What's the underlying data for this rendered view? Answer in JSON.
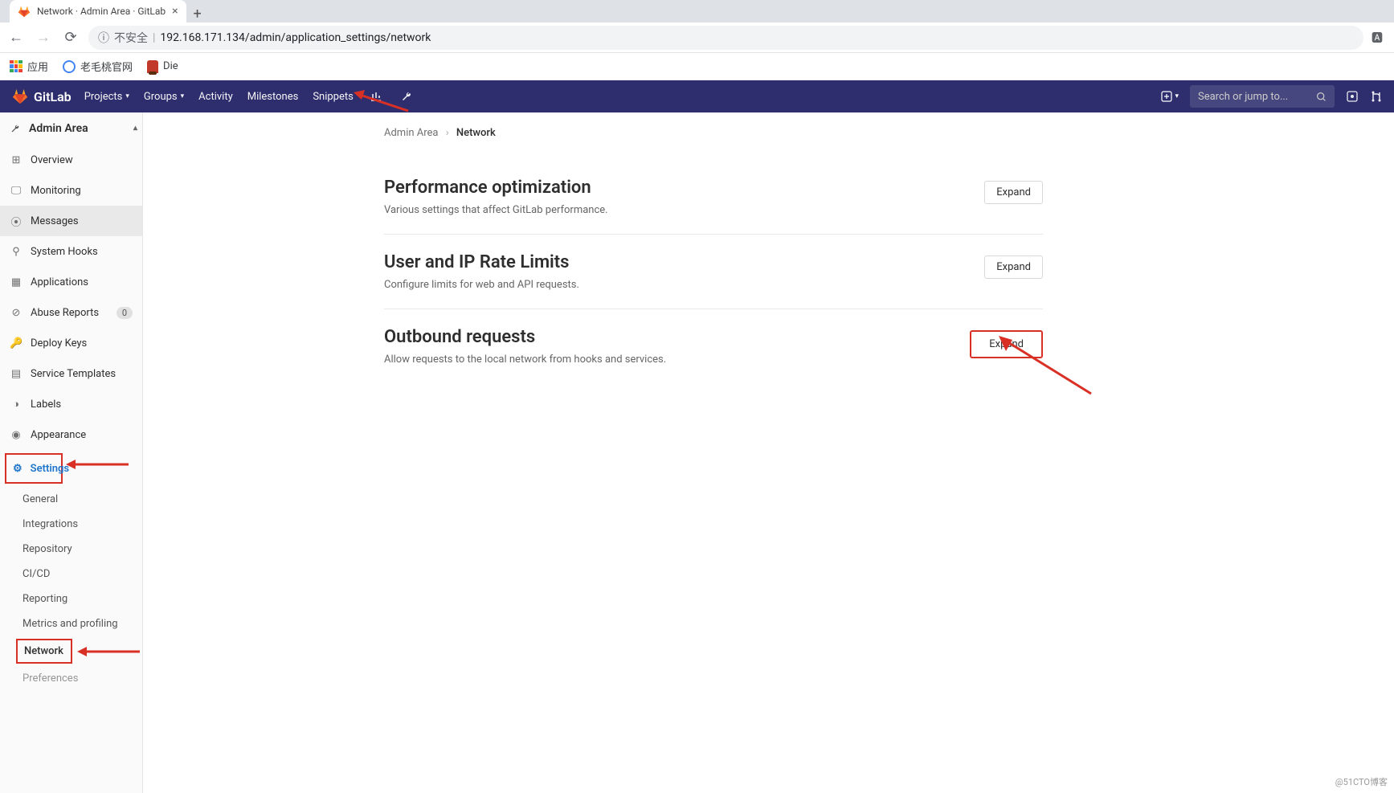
{
  "browser": {
    "tab_title": "Network · Admin Area · GitLab",
    "url_prefix_label": "不安全",
    "url": "192.168.171.134/admin/application_settings/network",
    "bookmarks": {
      "apps": "应用",
      "laomaotao": "老毛桃官网",
      "die": "Die"
    }
  },
  "header": {
    "brand": "GitLab",
    "nav": {
      "projects": "Projects",
      "groups": "Groups",
      "activity": "Activity",
      "milestones": "Milestones",
      "snippets": "Snippets"
    },
    "search_placeholder": "Search or jump to..."
  },
  "sidebar": {
    "title": "Admin Area",
    "items": {
      "overview": "Overview",
      "monitoring": "Monitoring",
      "messages": "Messages",
      "system_hooks": "System Hooks",
      "applications": "Applications",
      "abuse_reports": "Abuse Reports",
      "abuse_reports_count": "0",
      "deploy_keys": "Deploy Keys",
      "service_templates": "Service Templates",
      "labels": "Labels",
      "appearance": "Appearance"
    },
    "settings": {
      "header": "Settings",
      "general": "General",
      "integrations": "Integrations",
      "repository": "Repository",
      "cicd": "CI/CD",
      "reporting": "Reporting",
      "metrics": "Metrics and profiling",
      "network": "Network",
      "preferences": "Preferences"
    }
  },
  "breadcrumb": {
    "admin_area": "Admin Area",
    "current": "Network"
  },
  "sections": {
    "perf": {
      "title": "Performance optimization",
      "desc": "Various settings that affect GitLab performance.",
      "btn": "Expand"
    },
    "rate": {
      "title": "User and IP Rate Limits",
      "desc": "Configure limits for web and API requests.",
      "btn": "Expand"
    },
    "outbound": {
      "title": "Outbound requests",
      "desc": "Allow requests to the local network from hooks and services.",
      "btn": "Expand"
    }
  },
  "watermark": "@51CTO博客"
}
